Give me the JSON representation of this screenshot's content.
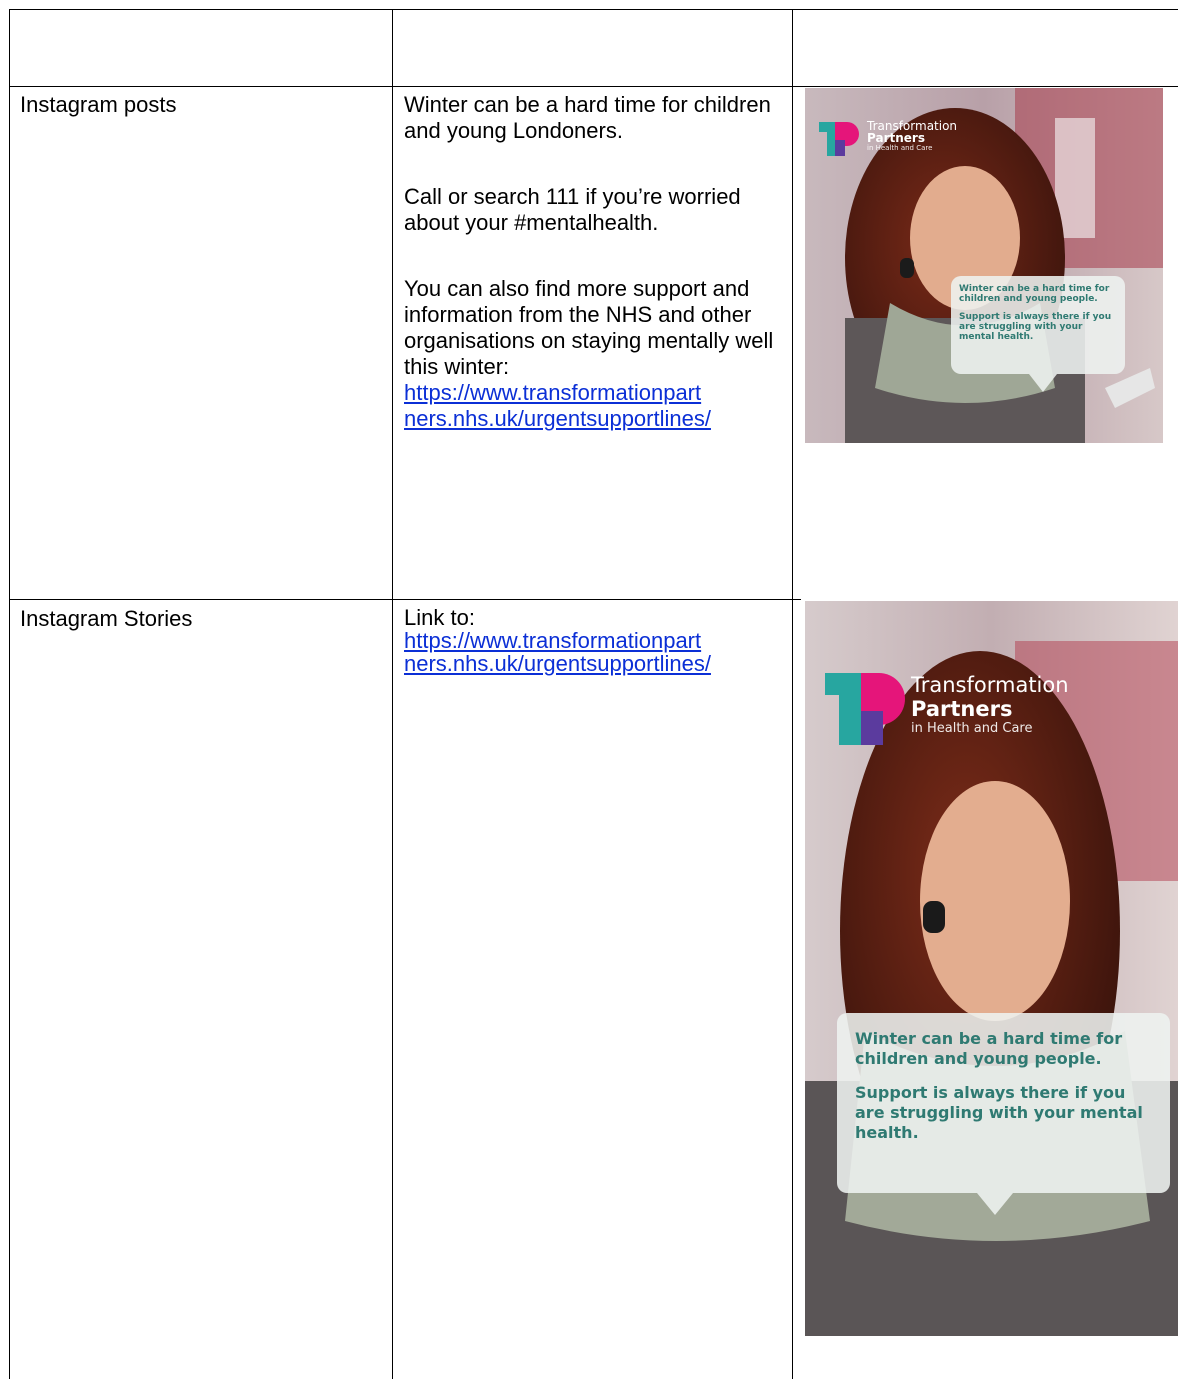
{
  "rows": [
    {
      "channel": "Instagram posts",
      "copy": [
        "Winter can be a hard time for children and young Londoners.",
        "Call or search 111 if you’re worried about your #mentalhealth.",
        "You can also find more support and information from the NHS and other organisations on staying mentally well this winter:"
      ],
      "link_line1": "https://www.transformationpart",
      "link_line2": "ners.nhs.uk/urgentsupportlines/"
    },
    {
      "channel": "Instagram Stories",
      "copy_prefix": "Link to:",
      "link_line1": "https://www.transformationpart",
      "link_line2": "ners.nhs.uk/urgentsupportlines/"
    }
  ],
  "promo": {
    "logo_line1": "Transformation",
    "logo_line2": "Partners",
    "logo_line3": "in Health and Care",
    "bubble_line1": "Winter can be a hard time for children and young people.",
    "bubble_line2": "Support is always there if you are struggling with your mental health.",
    "colors": {
      "teal": "#2f7a72",
      "logo_teal": "#27a6a0",
      "logo_pink": "#e5157a",
      "logo_purple": "#5b3b9e"
    }
  }
}
